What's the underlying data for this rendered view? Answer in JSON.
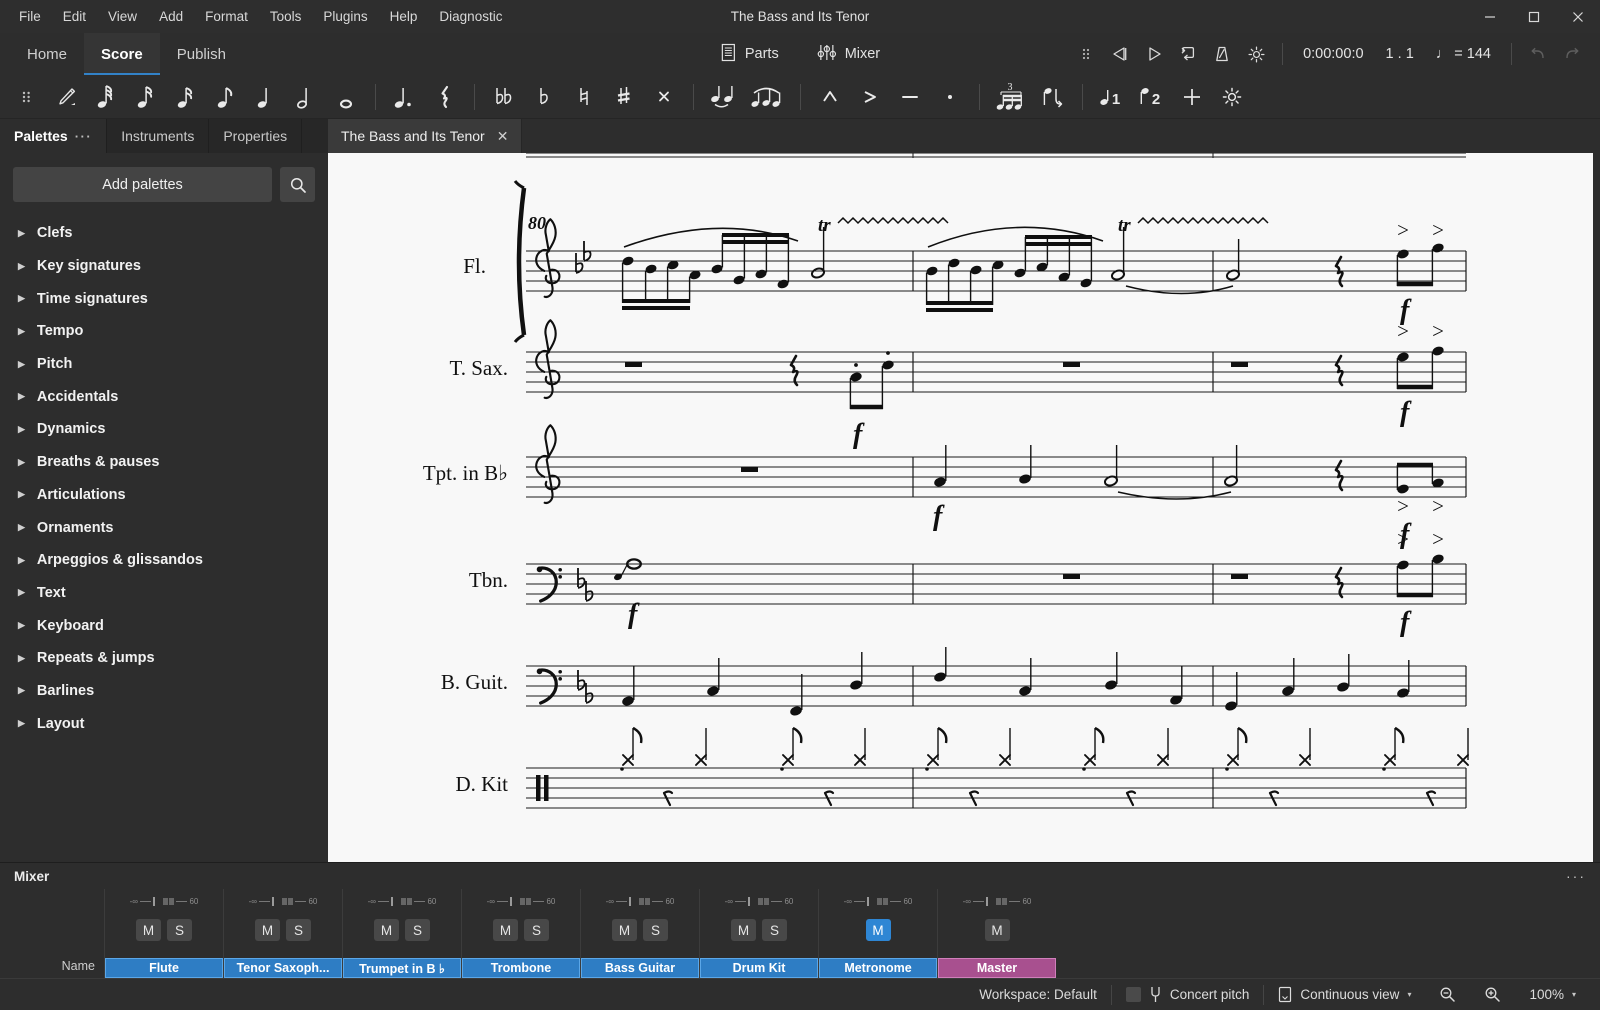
{
  "window": {
    "title": "The Bass and Its Tenor",
    "minimize": "─",
    "maximize": "☐",
    "close": "✕"
  },
  "menubar": {
    "items": [
      {
        "label": "File"
      },
      {
        "label": "Edit"
      },
      {
        "label": "View"
      },
      {
        "label": "Add"
      },
      {
        "label": "Format"
      },
      {
        "label": "Tools"
      },
      {
        "label": "Plugins"
      },
      {
        "label": "Help"
      },
      {
        "label": "Diagnostic"
      }
    ]
  },
  "mode_tabs": [
    {
      "label": "Home",
      "active": false
    },
    {
      "label": "Score",
      "active": true
    },
    {
      "label": "Publish",
      "active": false
    }
  ],
  "center_buttons": [
    {
      "label": "Parts",
      "icon": "parts-icon"
    },
    {
      "label": "Mixer",
      "icon": "mixer-icon"
    }
  ],
  "playback": {
    "drag_handle": "grip-icon",
    "rewind": "rewind-icon",
    "play": "play-icon",
    "loop": "loop-icon",
    "metronome": "metronome-icon",
    "settings": "gear-icon",
    "time": "0:00:00:0",
    "position": "1 . 1",
    "tempo_note": "♩",
    "tempo": "= 144",
    "undo": "undo-icon",
    "redo": "redo-icon"
  },
  "note_input_toolbar": {
    "groups": [
      {
        "items": [
          {
            "name": "toolbar-grip",
            "glyph": "⁙",
            "kind": "grip"
          },
          {
            "name": "note-input-pencil",
            "glyph": "✎",
            "kind": "pencil"
          }
        ]
      },
      {
        "items": [
          {
            "name": "duration-64th",
            "glyph": "♫",
            "kind": "note64"
          },
          {
            "name": "duration-32nd",
            "glyph": "♫",
            "kind": "note32"
          },
          {
            "name": "duration-16th",
            "glyph": "♬",
            "kind": "note16"
          },
          {
            "name": "duration-eighth",
            "glyph": "♪",
            "kind": "note8"
          },
          {
            "name": "duration-quarter",
            "glyph": "♩",
            "kind": "note4"
          },
          {
            "name": "duration-half",
            "glyph": "♩",
            "kind": "note2"
          },
          {
            "name": "duration-whole",
            "glyph": "○",
            "kind": "note1"
          }
        ]
      },
      {
        "items": [
          {
            "name": "augmentation-dot",
            "glyph": "♩.",
            "kind": "dotted"
          },
          {
            "name": "rest",
            "glyph": "𝄽",
            "kind": "rest"
          }
        ]
      },
      {
        "items": [
          {
            "name": "double-flat",
            "glyph": "♭♭",
            "kind": "dflat"
          },
          {
            "name": "flat",
            "glyph": "♭",
            "kind": "flat"
          },
          {
            "name": "natural",
            "glyph": "♮",
            "kind": "natural"
          },
          {
            "name": "sharp",
            "glyph": "♯",
            "kind": "sharp"
          },
          {
            "name": "double-sharp",
            "glyph": "×",
            "kind": "dsharp"
          }
        ]
      },
      {
        "items": [
          {
            "name": "tie",
            "glyph": "",
            "kind": "tie"
          },
          {
            "name": "slur",
            "glyph": "",
            "kind": "slur"
          }
        ]
      },
      {
        "items": [
          {
            "name": "marcato",
            "glyph": "∧",
            "kind": "marcato"
          },
          {
            "name": "accent",
            "glyph": ">",
            "kind": "accent"
          },
          {
            "name": "tenuto",
            "glyph": "—",
            "kind": "tenuto"
          },
          {
            "name": "staccato",
            "glyph": "·",
            "kind": "staccato"
          }
        ]
      },
      {
        "items": [
          {
            "name": "tuplet",
            "glyph": "3",
            "kind": "tuplet"
          },
          {
            "name": "flip-direction",
            "glyph": "",
            "kind": "flip"
          }
        ]
      },
      {
        "items": [
          {
            "name": "voice-1",
            "glyph": "1",
            "kind": "voice1"
          },
          {
            "name": "voice-2",
            "glyph": "2",
            "kind": "voice2"
          }
        ]
      },
      {
        "items": [
          {
            "name": "add-element",
            "glyph": "+",
            "kind": "plus"
          },
          {
            "name": "toolbar-settings",
            "glyph": "⚙",
            "kind": "gear"
          }
        ]
      }
    ]
  },
  "panel_tabs": [
    {
      "label": "Palettes",
      "active": true,
      "has_menu": true,
      "menu_glyph": "···"
    },
    {
      "label": "Instruments",
      "active": false,
      "has_menu": false
    },
    {
      "label": "Properties",
      "active": false,
      "has_menu": false
    }
  ],
  "palettes": {
    "add_button": "Add palettes",
    "search_icon": "search-icon",
    "items": [
      {
        "label": "Clefs"
      },
      {
        "label": "Key signatures"
      },
      {
        "label": "Time signatures"
      },
      {
        "label": "Tempo"
      },
      {
        "label": "Pitch"
      },
      {
        "label": "Accidentals"
      },
      {
        "label": "Dynamics"
      },
      {
        "label": "Breaths & pauses"
      },
      {
        "label": "Articulations"
      },
      {
        "label": "Ornaments"
      },
      {
        "label": "Arpeggios & glissandos"
      },
      {
        "label": "Text"
      },
      {
        "label": "Keyboard"
      },
      {
        "label": "Repeats & jumps"
      },
      {
        "label": "Barlines"
      },
      {
        "label": "Layout"
      }
    ]
  },
  "document_tabs": [
    {
      "label": "The Bass and Its Tenor",
      "close": "✕",
      "active": true
    }
  ],
  "score": {
    "measure_number": "80",
    "key_signature": "2 flats (B-flat major / G minor)",
    "staves": [
      {
        "label": "Fl.",
        "clef": "treble",
        "name": "Flute"
      },
      {
        "label": "T. Sax.",
        "clef": "treble",
        "name": "Tenor Saxophone"
      },
      {
        "label": "Tpt. in B♭",
        "clef": "treble",
        "name": "Trumpet in B-flat"
      },
      {
        "label": "Tbn.",
        "clef": "bass",
        "name": "Trombone"
      },
      {
        "label": "B. Guit.",
        "clef": "bass",
        "name": "Bass Guitar"
      },
      {
        "label": "D. Kit",
        "clef": "percussion",
        "name": "Drum Kit"
      }
    ],
    "markings": {
      "trill": "tr",
      "dynamic_forte": "f",
      "accent": ">"
    }
  },
  "mixer": {
    "title": "Mixer",
    "menu_glyph": "···",
    "name_row_label": "Name",
    "mute_label": "M",
    "solo_label": "S",
    "volume_min_label": "-∞",
    "pan_label": "60",
    "channels": [
      {
        "name": "Flute",
        "mute": false,
        "solo": false,
        "has_solo": true,
        "master": false
      },
      {
        "name": "Tenor Saxoph...",
        "mute": false,
        "solo": false,
        "has_solo": true,
        "master": false
      },
      {
        "name": "Trumpet in B ♭",
        "mute": false,
        "solo": false,
        "has_solo": true,
        "master": false
      },
      {
        "name": "Trombone",
        "mute": false,
        "solo": false,
        "has_solo": true,
        "master": false
      },
      {
        "name": "Bass Guitar",
        "mute": false,
        "solo": false,
        "has_solo": true,
        "master": false
      },
      {
        "name": "Drum Kit",
        "mute": false,
        "solo": false,
        "has_solo": true,
        "master": false
      },
      {
        "name": "Metronome",
        "mute": true,
        "solo": false,
        "has_solo": false,
        "master": false
      },
      {
        "name": "Master",
        "mute": false,
        "solo": false,
        "has_solo": false,
        "master": true
      }
    ]
  },
  "statusbar": {
    "workspace": "Workspace: Default",
    "concert_pitch": "Concert pitch",
    "concert_pitch_icon": "tuning-fork-icon",
    "view_mode": "Continuous view",
    "view_mode_icon": "page-view-icon",
    "zoom_out_icon": "zoom-out-icon",
    "zoom_in_icon": "zoom-in-icon",
    "zoom_level": "100%",
    "caret": "▾"
  },
  "colors": {
    "accent": "#2e7dc4",
    "master": "#a8508f",
    "chrome": "#2d2d2d",
    "page": "#f8f8f8",
    "active_tab_underline": "#3282c8"
  }
}
